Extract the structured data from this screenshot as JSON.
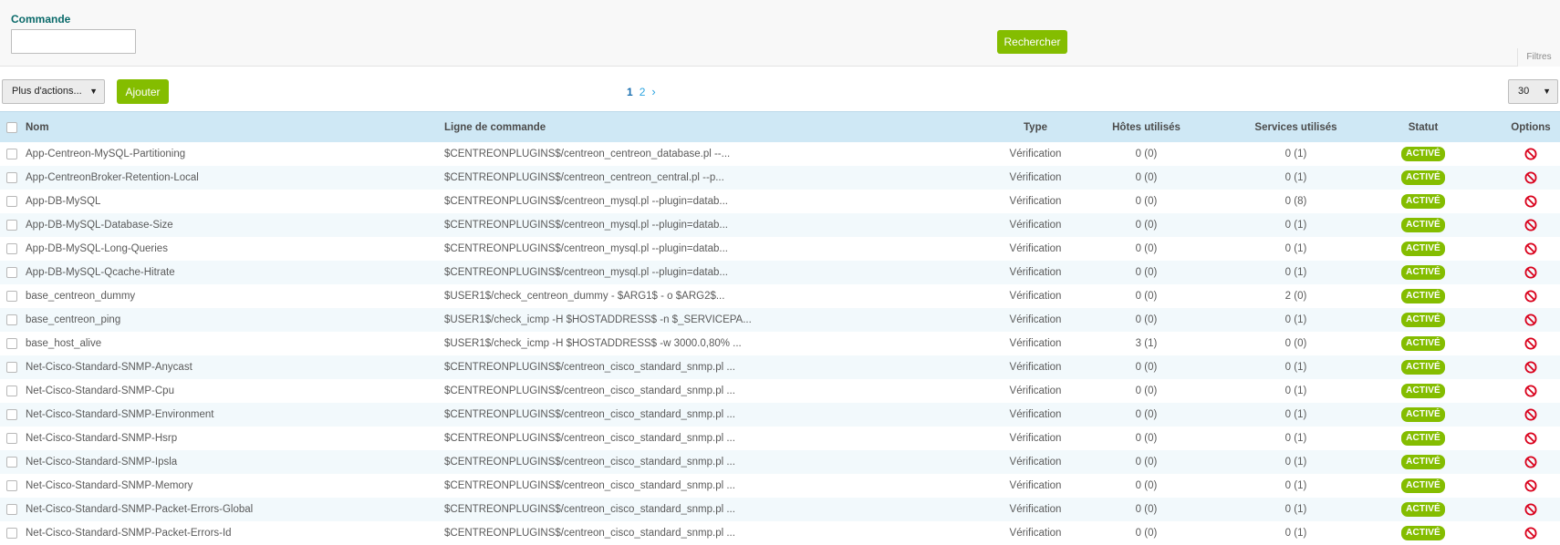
{
  "filters": {
    "label": "Commande",
    "input_value": "",
    "search_label": "Rechercher",
    "filters_tab": "Filtres"
  },
  "toolbar": {
    "more_actions": "Plus d'actions...",
    "add_label": "Ajouter",
    "pagination": {
      "current": "1",
      "pages": [
        "2"
      ],
      "next": "›"
    },
    "per_page": "30"
  },
  "table": {
    "headers": {
      "name": "Nom",
      "command": "Ligne de commande",
      "type": "Type",
      "hosts": "Hôtes utilisés",
      "services": "Services utilisés",
      "status": "Statut",
      "options": "Options"
    },
    "rows": [
      {
        "name": "App-Centreon-MySQL-Partitioning",
        "command": "$CENTREONPLUGINS$/centreon_centreon_database.pl --...",
        "type": "Vérification",
        "hosts": "0 (0)",
        "services": "0 (1)",
        "status": "ACTIVÉ"
      },
      {
        "name": "App-CentreonBroker-Retention-Local",
        "command": "$CENTREONPLUGINS$/centreon_centreon_central.pl --p...",
        "type": "Vérification",
        "hosts": "0 (0)",
        "services": "0 (1)",
        "status": "ACTIVÉ"
      },
      {
        "name": "App-DB-MySQL",
        "command": "$CENTREONPLUGINS$/centreon_mysql.pl --plugin=datab...",
        "type": "Vérification",
        "hosts": "0 (0)",
        "services": "0 (8)",
        "status": "ACTIVÉ"
      },
      {
        "name": "App-DB-MySQL-Database-Size",
        "command": "$CENTREONPLUGINS$/centreon_mysql.pl --plugin=datab...",
        "type": "Vérification",
        "hosts": "0 (0)",
        "services": "0 (1)",
        "status": "ACTIVÉ"
      },
      {
        "name": "App-DB-MySQL-Long-Queries",
        "command": "$CENTREONPLUGINS$/centreon_mysql.pl --plugin=datab...",
        "type": "Vérification",
        "hosts": "0 (0)",
        "services": "0 (1)",
        "status": "ACTIVÉ"
      },
      {
        "name": "App-DB-MySQL-Qcache-Hitrate",
        "command": "$CENTREONPLUGINS$/centreon_mysql.pl --plugin=datab...",
        "type": "Vérification",
        "hosts": "0 (0)",
        "services": "0 (1)",
        "status": "ACTIVÉ"
      },
      {
        "name": "base_centreon_dummy",
        "command": "$USER1$/check_centreon_dummy - $ARG1$ - o $ARG2$...",
        "type": "Vérification",
        "hosts": "0 (0)",
        "services": "2 (0)",
        "status": "ACTIVÉ"
      },
      {
        "name": "base_centreon_ping",
        "command": "$USER1$/check_icmp -H $HOSTADDRESS$ -n $_SERVICEPA...",
        "type": "Vérification",
        "hosts": "0 (0)",
        "services": "0 (1)",
        "status": "ACTIVÉ"
      },
      {
        "name": "base_host_alive",
        "command": "$USER1$/check_icmp -H $HOSTADDRESS$ -w 3000.0,80% ...",
        "type": "Vérification",
        "hosts": "3 (1)",
        "services": "0 (0)",
        "status": "ACTIVÉ"
      },
      {
        "name": "Net-Cisco-Standard-SNMP-Anycast",
        "command": "$CENTREONPLUGINS$/centreon_cisco_standard_snmp.pl ...",
        "type": "Vérification",
        "hosts": "0 (0)",
        "services": "0 (1)",
        "status": "ACTIVÉ"
      },
      {
        "name": "Net-Cisco-Standard-SNMP-Cpu",
        "command": "$CENTREONPLUGINS$/centreon_cisco_standard_snmp.pl ...",
        "type": "Vérification",
        "hosts": "0 (0)",
        "services": "0 (1)",
        "status": "ACTIVÉ"
      },
      {
        "name": "Net-Cisco-Standard-SNMP-Environment",
        "command": "$CENTREONPLUGINS$/centreon_cisco_standard_snmp.pl ...",
        "type": "Vérification",
        "hosts": "0 (0)",
        "services": "0 (1)",
        "status": "ACTIVÉ"
      },
      {
        "name": "Net-Cisco-Standard-SNMP-Hsrp",
        "command": "$CENTREONPLUGINS$/centreon_cisco_standard_snmp.pl ...",
        "type": "Vérification",
        "hosts": "0 (0)",
        "services": "0 (1)",
        "status": "ACTIVÉ"
      },
      {
        "name": "Net-Cisco-Standard-SNMP-Ipsla",
        "command": "$CENTREONPLUGINS$/centreon_cisco_standard_snmp.pl ...",
        "type": "Vérification",
        "hosts": "0 (0)",
        "services": "0 (1)",
        "status": "ACTIVÉ"
      },
      {
        "name": "Net-Cisco-Standard-SNMP-Memory",
        "command": "$CENTREONPLUGINS$/centreon_cisco_standard_snmp.pl ...",
        "type": "Vérification",
        "hosts": "0 (0)",
        "services": "0 (1)",
        "status": "ACTIVÉ"
      },
      {
        "name": "Net-Cisco-Standard-SNMP-Packet-Errors-Global",
        "command": "$CENTREONPLUGINS$/centreon_cisco_standard_snmp.pl ...",
        "type": "Vérification",
        "hosts": "0 (0)",
        "services": "0 (1)",
        "status": "ACTIVÉ"
      },
      {
        "name": "Net-Cisco-Standard-SNMP-Packet-Errors-Id",
        "command": "$CENTREONPLUGINS$/centreon_cisco_standard_snmp.pl ...",
        "type": "Vérification",
        "hosts": "0 (0)",
        "services": "0 (1)",
        "status": "ACTIVÉ"
      }
    ]
  },
  "colors": {
    "accent_green": "#84bd00",
    "header_blue": "#cfe8f5",
    "option_red": "#d9001b"
  },
  "icons": {
    "option": "ban-icon",
    "dropdown": "caret-down-icon"
  }
}
